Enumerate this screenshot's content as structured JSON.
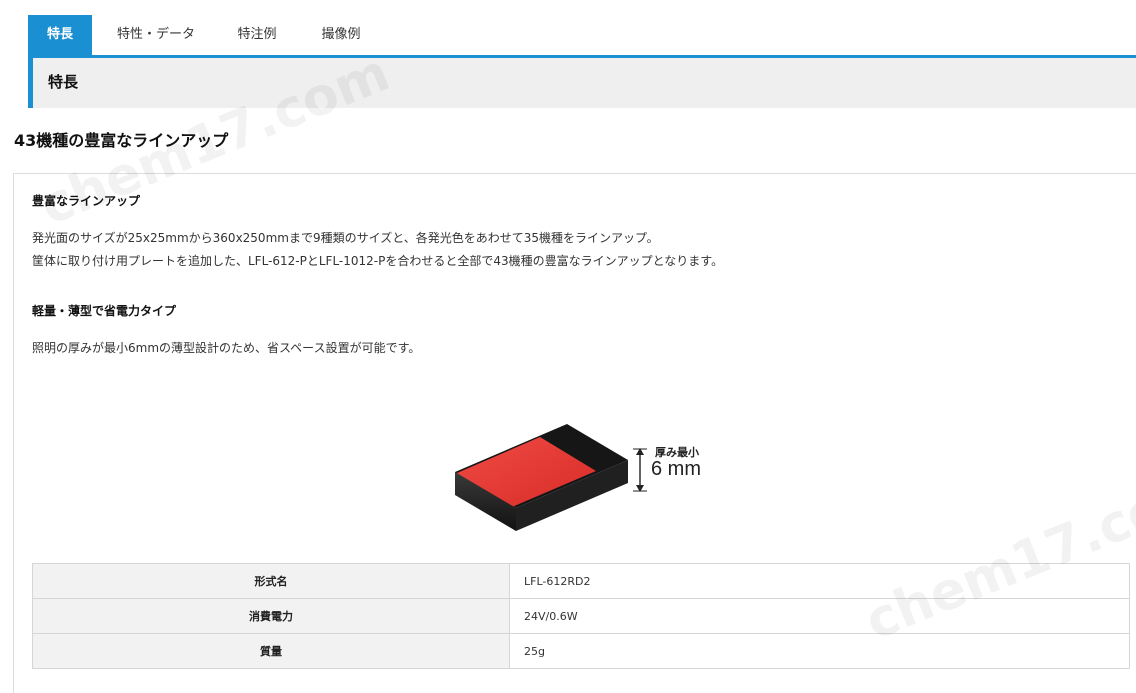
{
  "tabs": [
    {
      "label": "特長",
      "active": true
    },
    {
      "label": "特性・データ",
      "active": false
    },
    {
      "label": "特注例",
      "active": false
    },
    {
      "label": "撮像例",
      "active": false
    }
  ],
  "section_title": "特長",
  "main_heading": "43機種の豊富なラインアップ",
  "lineup": {
    "title": "豊富なラインアップ",
    "line1": "発光面のサイズが25x25mmから360x250mmまで9種類のサイズと、各発光色をあわせて35機種をラインアップ。",
    "line2": "筐体に取り付け用プレートを追加した、LFL-612-PとLFL-1012-Pを合わせると全部で43機種の豊富なラインアップとなります。"
  },
  "thin": {
    "title": "軽量・薄型で省電力タイプ",
    "line1": "照明の厚みが最小6mmの薄型設計のため、省スペース設置が可能です。"
  },
  "illustration": {
    "label": "厚み最小",
    "value": "6 mm",
    "emit_color": "#e8332e"
  },
  "spec": [
    {
      "key": "形式名",
      "value": "LFL-612RD2"
    },
    {
      "key": "消費電力",
      "value": "24V/0.6W"
    },
    {
      "key": "質量",
      "value": "25g"
    }
  ],
  "watermark": "chem17.com",
  "colors": {
    "accent": "#1a8fd1"
  }
}
